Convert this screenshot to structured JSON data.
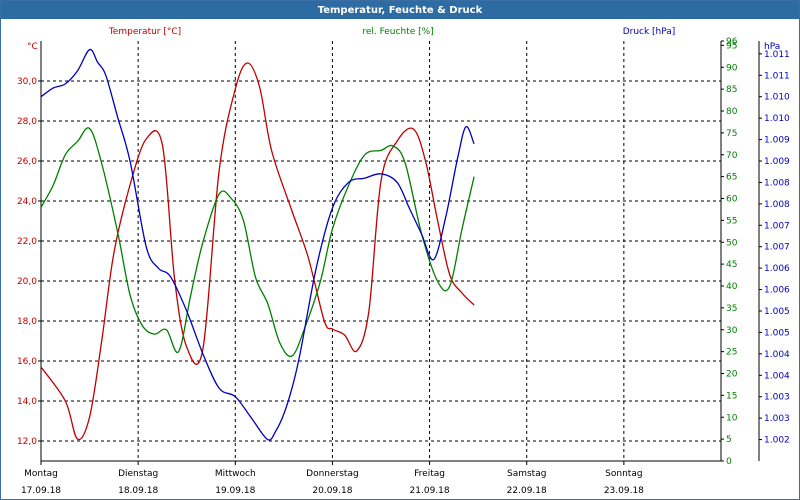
{
  "window": {
    "title": "Temperatur, Feuchte & Druck"
  },
  "colors": {
    "temperature": "#c00000",
    "humidity": "#008000",
    "pressure": "#0000c0",
    "grid": "#000000",
    "titlebar": "#2d6ba3"
  },
  "chart_data": {
    "type": "line",
    "title": "Temperatur, Feuchte & Druck",
    "x_ticks": [
      {
        "day": "Montag",
        "date": "17.09.18"
      },
      {
        "day": "Dienstag",
        "date": "18.09.18"
      },
      {
        "day": "Mittwoch",
        "date": "19.09.18"
      },
      {
        "day": "Donnerstag",
        "date": "20.09.18"
      },
      {
        "day": "Freitag",
        "date": "21.09.18"
      },
      {
        "day": "Samstag",
        "date": "22.09.18"
      },
      {
        "day": "Sonntag",
        "date": "23.09.18"
      }
    ],
    "xlim": [
      "17.09.18 00:00",
      "24.09.18 00:00"
    ],
    "grid": true,
    "axes": {
      "temperature": {
        "label": "Temperatur [°C]",
        "unit": "°C",
        "ylim": [
          11,
          32
        ],
        "ticks": [
          "30,0",
          "28,0",
          "26,0",
          "24,0",
          "22,0",
          "20,0",
          "18,0",
          "16,0",
          "14,0",
          "12,0"
        ],
        "tick_values": [
          30,
          28,
          26,
          24,
          22,
          20,
          18,
          16,
          14,
          12
        ]
      },
      "humidity": {
        "label": "rel. Feuchte [%]",
        "unit": "%",
        "ylim": [
          0,
          96
        ],
        "ticks": [
          "96",
          "95",
          "90",
          "85",
          "80",
          "75",
          "70",
          "65",
          "60",
          "55",
          "50",
          "45",
          "40",
          "35",
          "30",
          "25",
          "20",
          "15",
          "10",
          "5",
          "0"
        ],
        "tick_values": [
          96,
          95,
          90,
          85,
          80,
          75,
          70,
          65,
          60,
          55,
          50,
          45,
          40,
          35,
          30,
          25,
          20,
          15,
          10,
          5,
          0
        ]
      },
      "pressure": {
        "label": "Druck [hPa]",
        "unit": "hPa",
        "ylim": [
          1001.5,
          1011.3
        ],
        "ticks": [
          "1.011",
          "1.011",
          "1.010",
          "1.010",
          "1.009",
          "1.009",
          "1.008",
          "1.008",
          "1.007",
          "1.007",
          "1.006",
          "1.006",
          "1.005",
          "1.005",
          "1.004",
          "1.004",
          "1.003",
          "1.003",
          "1.002"
        ],
        "tick_values": [
          1011.0,
          1010.5,
          1010.0,
          1009.5,
          1009.0,
          1008.5,
          1008.0,
          1007.5,
          1007.0,
          1006.5,
          1006.0,
          1005.5,
          1005.0,
          1004.5,
          1004.0,
          1003.5,
          1003.0,
          1002.5,
          1002.0
        ]
      }
    },
    "series": [
      {
        "name": "Temperatur [°C]",
        "axis": "temperature",
        "x_hours": [
          0,
          6,
          9,
          12,
          15,
          18,
          22,
          26,
          30,
          33,
          36,
          40,
          44,
          48,
          51,
          54,
          57,
          62,
          66,
          70,
          72,
          75,
          78,
          81,
          84,
          88,
          92,
          95,
          98,
          101,
          104,
          107
        ],
        "values": [
          15.7,
          14.0,
          12.1,
          13.2,
          17.0,
          21.4,
          24.8,
          27.1,
          26.8,
          20.1,
          16.7,
          16.6,
          25.5,
          29.6,
          30.9,
          29.7,
          26.5,
          23.5,
          21.2,
          18.0,
          17.6,
          17.3,
          16.5,
          18.5,
          25.0,
          27.0,
          27.6,
          26.0,
          23.0,
          20.3,
          19.4,
          18.8
        ]
      },
      {
        "name": "rel. Feuchte [%]",
        "axis": "humidity",
        "x_hours": [
          0,
          3,
          6,
          9,
          12,
          15,
          19,
          22,
          25,
          28,
          31,
          34,
          37,
          40,
          44,
          47,
          50,
          53,
          56,
          59,
          62,
          65,
          69,
          72,
          76,
          80,
          84,
          87,
          90,
          94,
          98,
          101,
          104,
          107
        ],
        "values": [
          58,
          63,
          70,
          73,
          76,
          68,
          52,
          38,
          31,
          29,
          30,
          25,
          38,
          50,
          61,
          60,
          55,
          42,
          36,
          27,
          24,
          30,
          41,
          53,
          63,
          70,
          71,
          72,
          68,
          52,
          41,
          40,
          53,
          65
        ]
      },
      {
        "name": "Druck [hPa]",
        "axis": "pressure",
        "x_hours": [
          0,
          3,
          6,
          9,
          12,
          14,
          16,
          19,
          22,
          26,
          29,
          32,
          36,
          40,
          44,
          48,
          52,
          56,
          58,
          60,
          62,
          64,
          68,
          72,
          76,
          80,
          84,
          88,
          91,
          94,
          97,
          100,
          103,
          105,
          107
        ],
        "values": [
          1010.0,
          1010.2,
          1010.3,
          1010.6,
          1011.1,
          1010.8,
          1010.5,
          1009.5,
          1008.5,
          1006.5,
          1006.0,
          1005.8,
          1005.0,
          1004.0,
          1003.2,
          1003.0,
          1002.5,
          1002.0,
          1002.2,
          1002.6,
          1003.2,
          1004.0,
          1006.0,
          1007.4,
          1008.0,
          1008.1,
          1008.2,
          1008.0,
          1007.4,
          1006.8,
          1006.2,
          1007.2,
          1008.6,
          1009.3,
          1008.9
        ]
      }
    ]
  }
}
